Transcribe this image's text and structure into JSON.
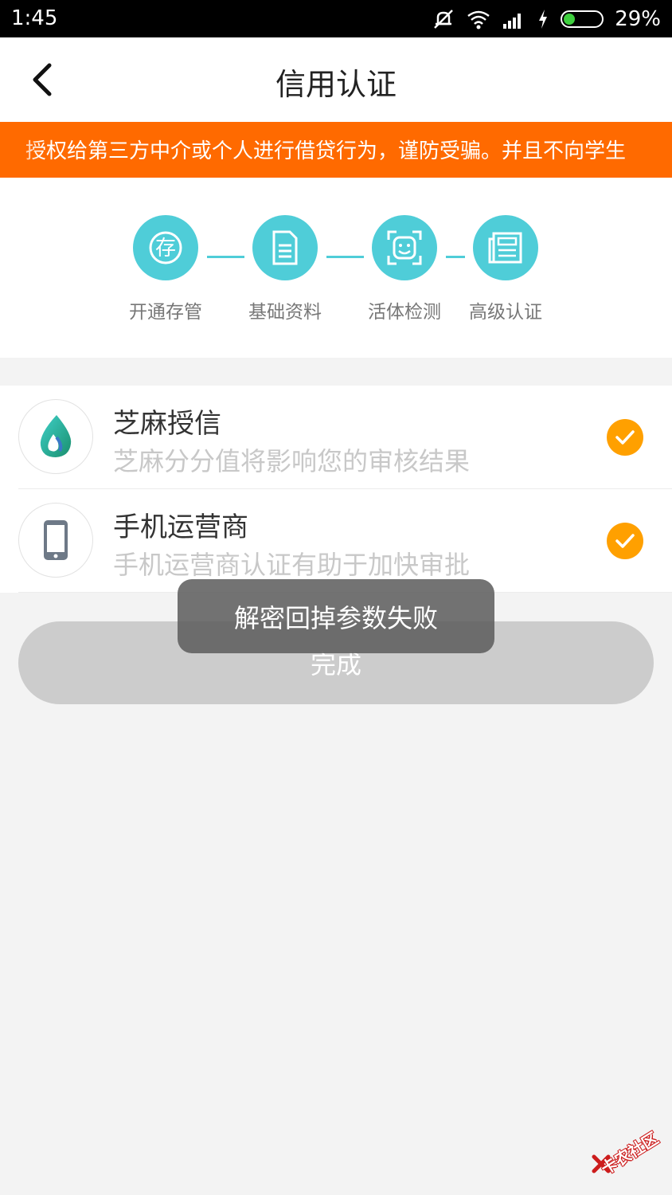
{
  "status_bar": {
    "time": "1:45",
    "battery_pct": "29%",
    "battery_color": "#3ecf3e"
  },
  "header": {
    "title": "信用认证"
  },
  "notice": {
    "text": "授权给第三方中介或个人进行借贷行为，谨防受骗。并且不向学生"
  },
  "steps": [
    {
      "label": "开通存管",
      "icon": "deposit-icon"
    },
    {
      "label": "基础资料",
      "icon": "document-icon"
    },
    {
      "label": "活体检测",
      "icon": "face-scan-icon"
    },
    {
      "label": "高级认证",
      "icon": "newspaper-icon"
    }
  ],
  "items": [
    {
      "title": "芝麻授信",
      "subtitle": "芝麻分分值将影响您的审核结果",
      "icon": "sesame-credit-icon",
      "status": "checked"
    },
    {
      "title": "手机运营商",
      "subtitle": "手机运营商认证有助于加快审批",
      "icon": "phone-icon",
      "status": "checked"
    }
  ],
  "done_button": {
    "label": "完成"
  },
  "toast": {
    "text": "解密回掉参数失败"
  },
  "watermark": {
    "text": "卡农社区"
  },
  "colors": {
    "accent_teal": "#4fcdd8",
    "notice_orange": "#ff6a00",
    "check_orange": "#ffa000",
    "button_disabled": "#cccccc"
  }
}
